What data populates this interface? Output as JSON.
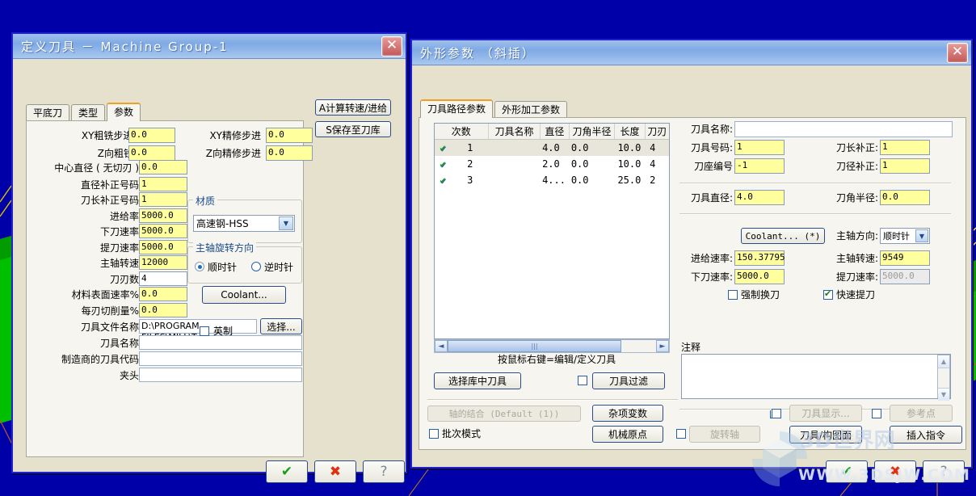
{
  "viewport": {
    "bg_color": "#0000a8",
    "geometry_color": "#00c000",
    "accent_color": "#c08000"
  },
  "left_dialog": {
    "title": "定义刀具  －  Machine Group-1",
    "close_label": "✕",
    "tabs": [
      {
        "label": "平底刀",
        "active": false
      },
      {
        "label": "类型",
        "active": false
      },
      {
        "label": "参数",
        "active": true
      }
    ],
    "top_buttons": [
      {
        "label": "A计算转速/进给"
      },
      {
        "label": "S保存至刀库"
      }
    ],
    "step_fields": [
      {
        "label": "XY粗铣步进 (%)",
        "value": "0.0"
      },
      {
        "label": "XY精修步进",
        "value": "0.0"
      },
      {
        "label": "Z向粗铣步进",
        "value": "0.0"
      },
      {
        "label": "Z向精修步进",
        "value": "0.0"
      }
    ],
    "params": [
      {
        "label": "中心直径 ( 无切刃 )",
        "value": "0.0",
        "style": "yellow"
      },
      {
        "label": "直径补正号码",
        "value": "1",
        "style": "yellow"
      },
      {
        "label": "刀长补正号码",
        "value": "1",
        "style": "yellow"
      },
      {
        "label": "进给率",
        "value": "5000.0",
        "style": "yellow"
      },
      {
        "label": "下刀速率",
        "value": "5000.0",
        "style": "yellow"
      },
      {
        "label": "提刀速率",
        "value": "5000.0",
        "style": "yellow"
      },
      {
        "label": "主轴转速",
        "value": "12000",
        "style": "yellow"
      },
      {
        "label": "刀刃数",
        "value": "4",
        "style": "white"
      },
      {
        "label": "材料表面速率%",
        "value": "0.0",
        "style": "yellow"
      },
      {
        "label": "每刃切削量%",
        "value": "0.0",
        "style": "yellow"
      }
    ],
    "text_rows": [
      {
        "label": "刀具文件名称",
        "value": "D:\\PROGRAM FILES\\MILL\\T"
      },
      {
        "label": "刀具名称",
        "value": ""
      },
      {
        "label": "制造商的刀具代码",
        "value": ""
      },
      {
        "label": "夹头",
        "value": ""
      }
    ],
    "browse_button": "选择...",
    "material_group": {
      "title": "材质",
      "selected": "高速钢-HSS"
    },
    "spindle_group": {
      "title": "主轴旋转方向",
      "options": [
        {
          "label": "顺时针",
          "selected": true
        },
        {
          "label": "逆时针",
          "selected": false
        }
      ]
    },
    "coolant_button": "Coolant...",
    "imperial_checkbox": {
      "label": "英制",
      "checked": false
    },
    "footer_buttons": [
      {
        "name": "ok",
        "glyph": "✔"
      },
      {
        "name": "cancel",
        "glyph": "✖"
      },
      {
        "name": "help",
        "glyph": "?"
      }
    ]
  },
  "right_dialog": {
    "title": "外形参数 （斜插）",
    "close_label": "✕",
    "tabs": [
      {
        "label": "刀具路径参数",
        "active": true
      },
      {
        "label": "外形加工参数",
        "active": false
      }
    ],
    "tool_list": {
      "headers": [
        "次数",
        "刀具名称",
        "直径",
        "刀角半径",
        "长度",
        "刀刃"
      ],
      "rows": [
        {
          "checked": true,
          "num": "1",
          "name": "",
          "dia": "4.0",
          "corner": "0.0",
          "len": "10.0",
          "flutes": "4"
        },
        {
          "checked": true,
          "num": "2",
          "name": "",
          "dia": "2.0",
          "corner": "0.0",
          "len": "10.0",
          "flutes": "4"
        },
        {
          "checked": true,
          "num": "3",
          "name": "",
          "dia": "4...",
          "corner": "0.0",
          "len": "25.0",
          "flutes": "2"
        }
      ]
    },
    "hint_text": "按鼠标右键=编辑/定义刀具",
    "left_buttons": {
      "select_from_library": "选择库中刀具",
      "tool_filter": "刀具过滤",
      "tool_filter_checked": false,
      "axis_combination": "轴的结合  (Default (1))",
      "misc_values": "杂项变数",
      "batch_mode": {
        "label": "批次模式",
        "checked": false
      },
      "machine_origin": "机械原点",
      "rotary_axis": "旋转轴",
      "rotary_axis_checked": false
    },
    "tool_fields": {
      "tool_name_label": "刀具名称:",
      "tool_name_value": "",
      "tool_number_label": "刀具号码:",
      "tool_number_value": "1",
      "length_offset_label": "刀长补正:",
      "length_offset_value": "1",
      "holder_number_label": "刀座编号",
      "holder_number_value": "-1",
      "dia_offset_label": "刀径补正:",
      "dia_offset_value": "1",
      "tool_dia_label": "刀具直径:",
      "tool_dia_value": "4.0",
      "corner_radius_label": "刀角半径:",
      "corner_radius_value": "0.0"
    },
    "speed_fields": {
      "coolant_button": "Coolant...  (*)",
      "spindle_dir_label": "主轴方向:",
      "spindle_dir_value": "顺时针",
      "feed_rate_label": "进给速率:",
      "feed_rate_value": "150.37795",
      "spindle_speed_label": "主轴转速:",
      "spindle_speed_value": "9549",
      "plunge_rate_label": "下刀速率:",
      "plunge_rate_value": "5000.0",
      "retract_rate_label": "提刀速率:",
      "retract_rate_value": "5000.0",
      "force_tool_change": {
        "label": "强制换刀",
        "checked": false
      },
      "rapid_retract": {
        "label": "快速提刀",
        "checked": true
      }
    },
    "comment_label": "注释",
    "comment_value": "",
    "bottom_buttons": {
      "tool_display": "刀具显示...",
      "tool_display_checked": false,
      "reference_point": "参考点",
      "reference_point_checked": false,
      "tool_plane": "刀具/构图面",
      "insert_command": "插入指令"
    },
    "footer_buttons": [
      {
        "name": "ok",
        "glyph": "✔"
      },
      {
        "name": "cancel",
        "glyph": "✖"
      },
      {
        "name": "help",
        "glyph": "?"
      }
    ]
  },
  "watermark": {
    "url": "WWW.3DSJW.COM",
    "brand": "3D世界网"
  }
}
